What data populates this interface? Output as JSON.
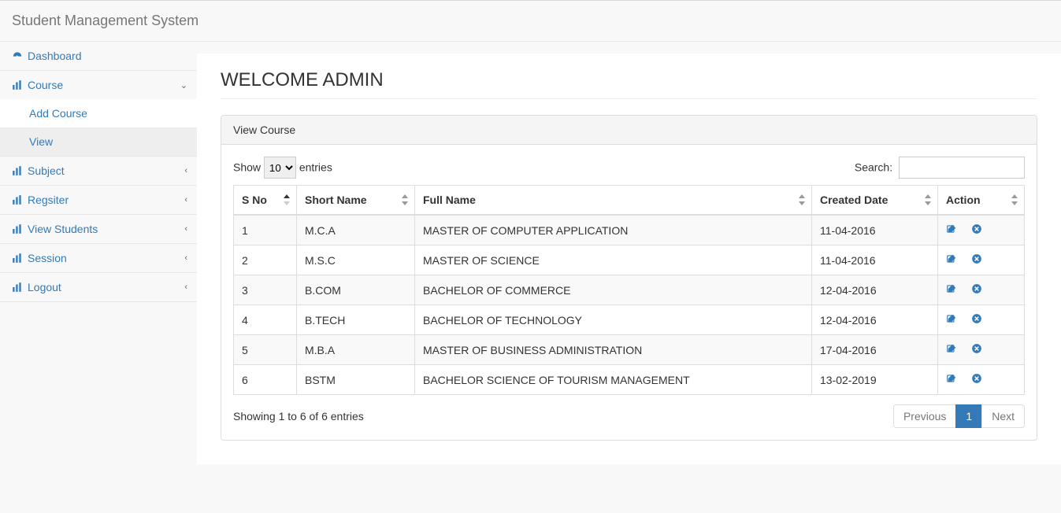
{
  "brand": "Student Management System",
  "sidebar": {
    "dashboard": "Dashboard",
    "course": "Course",
    "course_sub": {
      "add": "Add Course",
      "view": "View"
    },
    "subject": "Subject",
    "register": "Regsiter",
    "view_students": "View Students",
    "session": "Session",
    "logout": "Logout"
  },
  "page_title": "WELCOME ADMIN",
  "panel_title": "View Course",
  "dt": {
    "show": "Show",
    "entries": "entries",
    "length_value": "10",
    "search": "Search:",
    "info": "Showing 1 to 6 of 6 entries",
    "prev": "Previous",
    "page": "1",
    "next": "Next"
  },
  "columns": {
    "sno": "S No",
    "short": "Short Name",
    "full": "Full Name",
    "created": "Created Date",
    "action": "Action"
  },
  "rows": [
    {
      "sno": "1",
      "short": "M.C.A",
      "full": "MASTER OF COMPUTER APPLICATION",
      "created": "11-04-2016"
    },
    {
      "sno": "2",
      "short": "M.S.C",
      "full": "MASTER OF SCIENCE",
      "created": "11-04-2016"
    },
    {
      "sno": "3",
      "short": "B.COM",
      "full": "BACHELOR OF COMMERCE",
      "created": "12-04-2016"
    },
    {
      "sno": "4",
      "short": "B.TECH",
      "full": "BACHELOR OF TECHNOLOGY",
      "created": "12-04-2016"
    },
    {
      "sno": "5",
      "short": "M.B.A",
      "full": "MASTER OF BUSINESS ADMINISTRATION",
      "created": "17-04-2016"
    },
    {
      "sno": "6",
      "short": "BSTM",
      "full": "BACHELOR SCIENCE OF TOURISM MANAGEMENT",
      "created": "13-02-2019"
    }
  ]
}
